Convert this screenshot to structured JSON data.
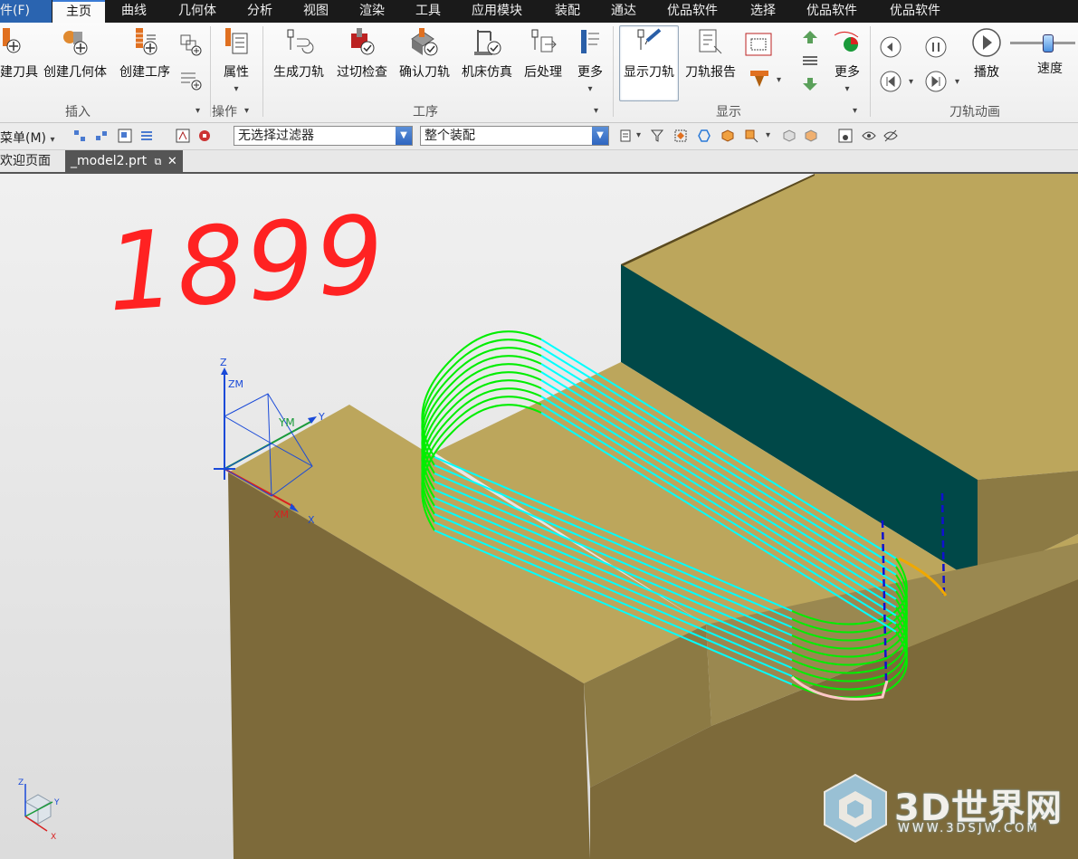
{
  "menu": {
    "items": [
      "件(F)",
      "主页",
      "曲线",
      "几何体",
      "分析",
      "视图",
      "渲染",
      "工具",
      "应用模块",
      "装配",
      "通达",
      "优品软件",
      "选择",
      "优品软件",
      "优品软件"
    ]
  },
  "ribbon": {
    "buttons": {
      "create_tool": "建刀具",
      "create_geometry": "创建几何体",
      "create_operation": "创建工序",
      "properties": "属性",
      "generate_path": "生成刀轨",
      "gouge_check": "过切检查",
      "verify_path": "确认刀轨",
      "machine_sim": "机床仿真",
      "postprocess": "后处理",
      "more_ops": "更多",
      "show_path": "显示刀轨",
      "path_report": "刀轨报告",
      "more_display": "更多",
      "play": "播放",
      "speed": "速度"
    },
    "groups": {
      "insert": "插入",
      "actions": "操作",
      "operations": "工序",
      "display": "显示",
      "animation": "刀轨动画"
    }
  },
  "toolbar": {
    "menu_label": "菜单(M)",
    "selection_filter": "无选择过滤器",
    "assembly_scope": "整个装配"
  },
  "tabs": {
    "welcome": "欢迎页面",
    "model": "_model2.prt"
  },
  "viewport": {
    "annotation": "1899",
    "axes": {
      "z": "Z",
      "zm": "ZM",
      "ym": "YM",
      "y": "Y",
      "xm": "XM",
      "x": "X"
    },
    "triad": {
      "z": "Z",
      "y": "Y",
      "x": "X"
    },
    "watermark": {
      "brand": "3D世界网",
      "url": "WWW.3DSJW.COM"
    },
    "colors": {
      "block_top": "#bca65c",
      "block_front": "#7d6a3a",
      "block_side": "#8c7a44",
      "wall": "#004848",
      "path_cut": "#00ffff",
      "path_arc": "#00ee00",
      "plunge": "#1010d0",
      "annotation": "#ff2222"
    }
  }
}
